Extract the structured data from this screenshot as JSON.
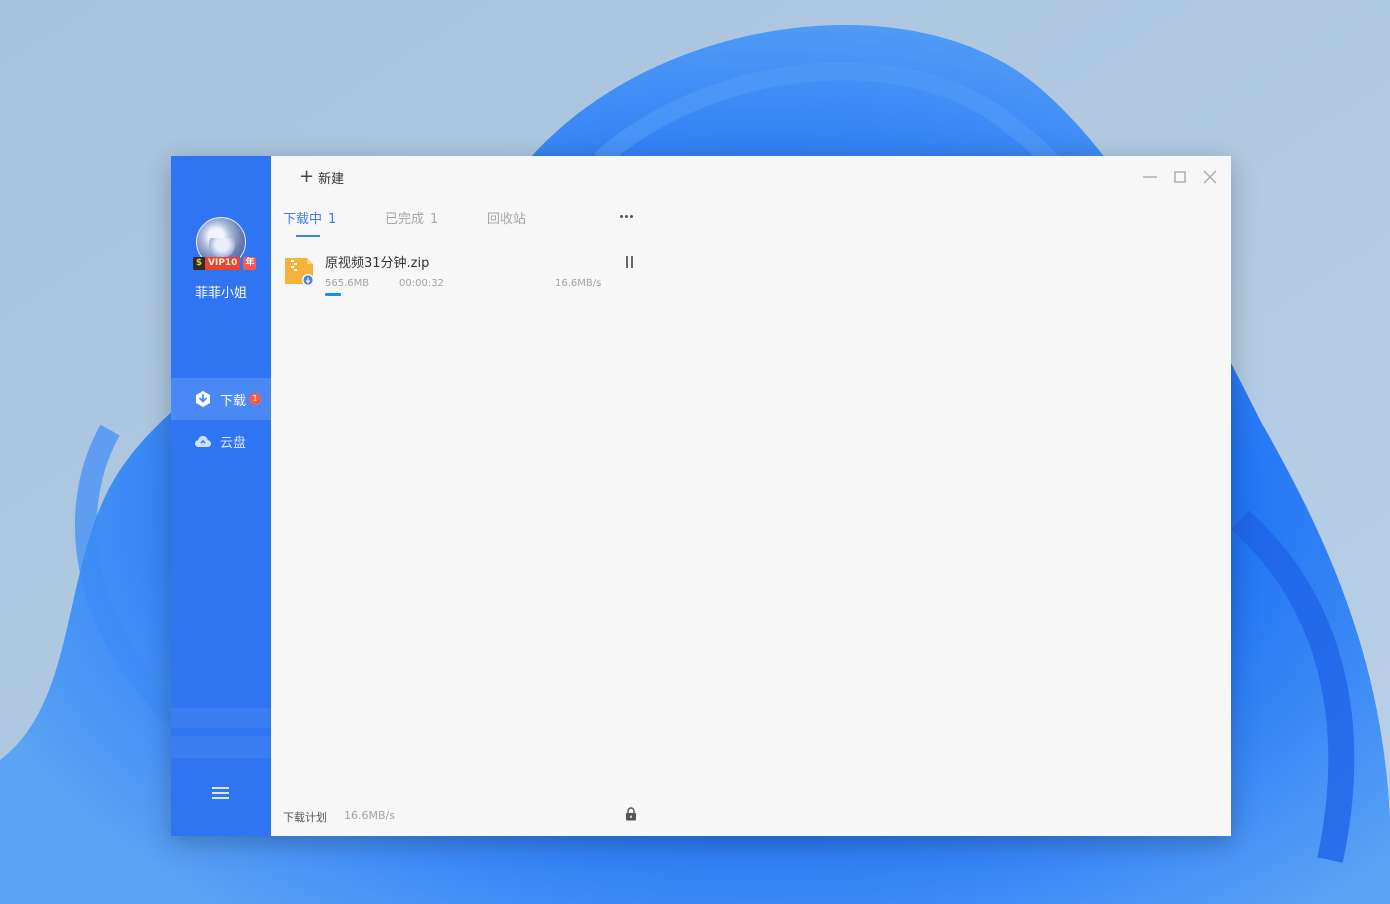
{
  "sidebar": {
    "user_name": "菲菲小姐",
    "vip": {
      "mark": "$",
      "text": "VIP10",
      "year": "年"
    },
    "nav": [
      {
        "label": "下载",
        "badge": "1",
        "icon": "download-icon"
      },
      {
        "label": "云盘",
        "icon": "cloud-icon"
      }
    ],
    "menu_icon": "hamburger-icon"
  },
  "toolbar": {
    "new_label": "新建",
    "new_icon": "plus-icon"
  },
  "window_controls": [
    "minimize-icon",
    "maximize-icon",
    "close-icon"
  ],
  "tabs": [
    {
      "label": "下载中",
      "count": "1"
    },
    {
      "label": "已完成",
      "count": "1"
    },
    {
      "label": "回收站"
    }
  ],
  "downloads": [
    {
      "file_name": "原视频31分钟.zip",
      "size": "565.6MB",
      "time_left": "00:00:32",
      "speed": "16.6MB/s",
      "progress": 0.05,
      "icon": "zip-file-icon"
    }
  ],
  "footer": {
    "plan_label": "下载计划",
    "speed": "16.6MB/s",
    "icon": "lock-icon"
  },
  "colors": {
    "sidebar": "#2f74f0",
    "accent": "#3f7ee9",
    "progress": "#1d8cf0",
    "badge": "#f25c4f"
  }
}
